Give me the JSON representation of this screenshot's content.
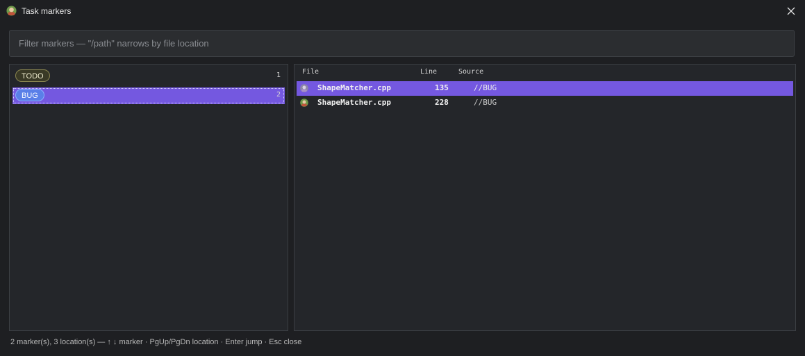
{
  "window": {
    "title": "Task markers",
    "app_icon": "face-icon",
    "close_icon": "close-icon"
  },
  "filter": {
    "placeholder": "Filter markers — \"/path\" narrows by file location",
    "value": ""
  },
  "markers": [
    {
      "label": "TODO",
      "count": "1",
      "selected": false
    },
    {
      "label": "BUG",
      "count": "2",
      "selected": true
    }
  ],
  "locations": {
    "headers": {
      "file": "File",
      "line": "Line",
      "source": "Source"
    },
    "rows": [
      {
        "file": "ShapeMatcher.cpp",
        "line": "135",
        "source": "//BUG",
        "selected": true
      },
      {
        "file": "ShapeMatcher.cpp",
        "line": "228",
        "source": "//BUG",
        "selected": false
      }
    ]
  },
  "status": "2 marker(s), 3 location(s) — ↑ ↓ marker · PgUp/PgDn location · Enter jump · Esc close",
  "colors": {
    "accent": "#7458e0",
    "background": "#1e1f22",
    "panel": "#24262a",
    "todo_tag": "#3a3a26",
    "bug_tag": "#5a7fe8"
  }
}
